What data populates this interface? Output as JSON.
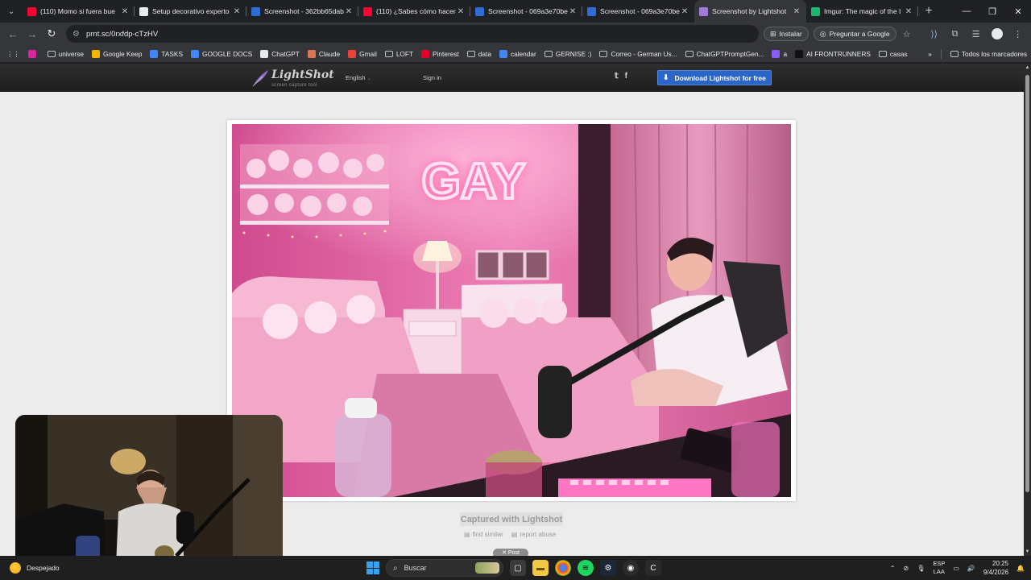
{
  "browser": {
    "tabs": [
      {
        "title": "(110) Momo si fuera bue",
        "favicon": "youtube-icon",
        "color": "#ff0033"
      },
      {
        "title": "Setup decorativo experto",
        "favicon": "chatgpt-icon",
        "color": "#e8eaed"
      },
      {
        "title": "Screenshot - 362bb65dab",
        "favicon": "screenshot-icon",
        "color": "#2f6cd6"
      },
      {
        "title": "(110) ¿Sabes cómo hacer",
        "favicon": "youtube-icon",
        "color": "#ff0033"
      },
      {
        "title": "Screenshot - 069a3e70be",
        "favicon": "screenshot-icon",
        "color": "#2f6cd6"
      },
      {
        "title": "Screenshot - 069a3e70be",
        "favicon": "screenshot-icon",
        "color": "#2f6cd6"
      },
      {
        "title": "Screenshot by Lightshot",
        "favicon": "lightshot-icon",
        "color": "#a07cd8"
      },
      {
        "title": "Imgur: The magic of the I",
        "favicon": "imgur-icon",
        "color": "#1bb76e"
      }
    ],
    "active_tab": 6,
    "url": "prnt.sc/0rxfdp-cTzHV",
    "install_label": "Instalar",
    "ask_google_label": "Preguntar a Google",
    "bookmarks": [
      {
        "label": "",
        "icon": "instagram-icon",
        "color": "#d6249f"
      },
      {
        "label": "universe",
        "icon": "folder-icon",
        "color": ""
      },
      {
        "label": "Google Keep",
        "icon": "keep-icon",
        "color": "#f6b400"
      },
      {
        "label": "TASKS",
        "icon": "tasks-icon",
        "color": "#4285f4"
      },
      {
        "label": "GOOGLE DOCS",
        "icon": "docs-icon",
        "color": "#4285f4"
      },
      {
        "label": "ChatGPT",
        "icon": "chatgpt-icon",
        "color": "#e8eaed"
      },
      {
        "label": "Claude",
        "icon": "claude-icon",
        "color": "#d97757"
      },
      {
        "label": "Gmail",
        "icon": "gmail-icon",
        "color": "#ea4335"
      },
      {
        "label": "LOFT",
        "icon": "folder-icon",
        "color": ""
      },
      {
        "label": "Pinterest",
        "icon": "pinterest-icon",
        "color": "#e60023"
      },
      {
        "label": "data",
        "icon": "folder-icon",
        "color": ""
      },
      {
        "label": "calendar",
        "icon": "calendar-icon",
        "color": "#4285f4"
      },
      {
        "label": "GERNISE :)",
        "icon": "folder-icon",
        "color": ""
      },
      {
        "label": "Correo - German Us...",
        "icon": "globe-icon",
        "color": ""
      },
      {
        "label": "ChatGPTPromptGen...",
        "icon": "globe-icon",
        "color": ""
      },
      {
        "label": "a",
        "icon": "app-icon",
        "color": "#8a5cf6"
      },
      {
        "label": "AI FRONTRUNNERS",
        "icon": "app-icon",
        "color": "#111111"
      },
      {
        "label": "casas",
        "icon": "folder-icon",
        "color": ""
      }
    ],
    "all_bookmarks_label": "Todos los marcadores"
  },
  "lightshot": {
    "logo_name": "LightShot",
    "logo_tagline": "screen capture tool",
    "language": "English",
    "signin": "Sign in",
    "download_label": "Download Lightshot for free",
    "photo_sign_text": "GAY",
    "captured_label": "Captured with Lightshot",
    "find_similar": "find similar",
    "report_abuse": "report abuse",
    "post_label": "Post"
  },
  "taskbar": {
    "weather": "Despejado",
    "search_placeholder": "Buscar",
    "lang_line1": "ESP",
    "lang_line2": "LAA",
    "time": "20:25",
    "date": "9/4/2026"
  },
  "colors": {
    "accent_blue": "#2b66c7",
    "neon_pink": "#ff5ca8"
  }
}
